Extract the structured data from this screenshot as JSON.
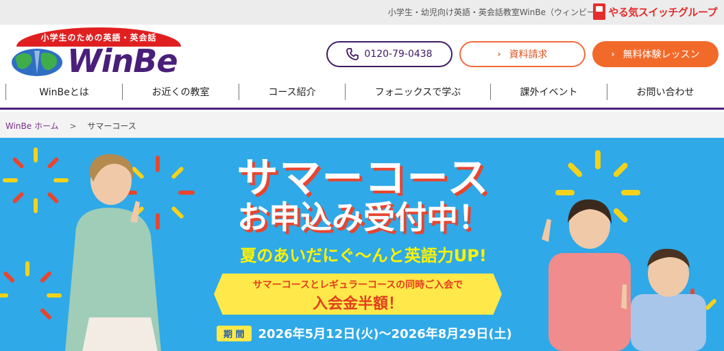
{
  "topbar": {
    "text": "小学生・幼児向け英語・英会話教室WinBe（ウィンビー）",
    "group_name": "やる気スイッチグループ"
  },
  "header": {
    "logo_ribbon": "小学生のための英語・英会話",
    "logo_word": "WinBe",
    "phone": "0120-79-0438",
    "doc_button": "資料請求",
    "trial_button": "無料体験レッスン"
  },
  "nav": {
    "items": [
      {
        "label": "WinBeとは"
      },
      {
        "label": "お近くの教室"
      },
      {
        "label": "コース紹介"
      },
      {
        "label": "フォニックスで学ぶ"
      },
      {
        "label": "課外イベント"
      },
      {
        "label": "お問い合わせ"
      }
    ]
  },
  "breadcrumb": {
    "home": "WinBe ホーム",
    "sep": ">",
    "current": "サマーコース"
  },
  "hero": {
    "title1": "サマーコース",
    "title2": "お申込み受付中！",
    "subtitle": "夏のあいだにぐ〜んと英語力UP!",
    "banner_line1": "サマーコースとレギュラーコースの同時ご入会で",
    "banner_line2": "入会金半額！",
    "period_label": "期 間",
    "period_text": "2026年5月12日(火)〜2026年8月29日(土)"
  },
  "colors": {
    "brand_purple": "#4a1f7a",
    "accent_orange": "#f26a2a",
    "hero_blue": "#2fa9e8",
    "banner_yellow": "#ffe94a"
  }
}
